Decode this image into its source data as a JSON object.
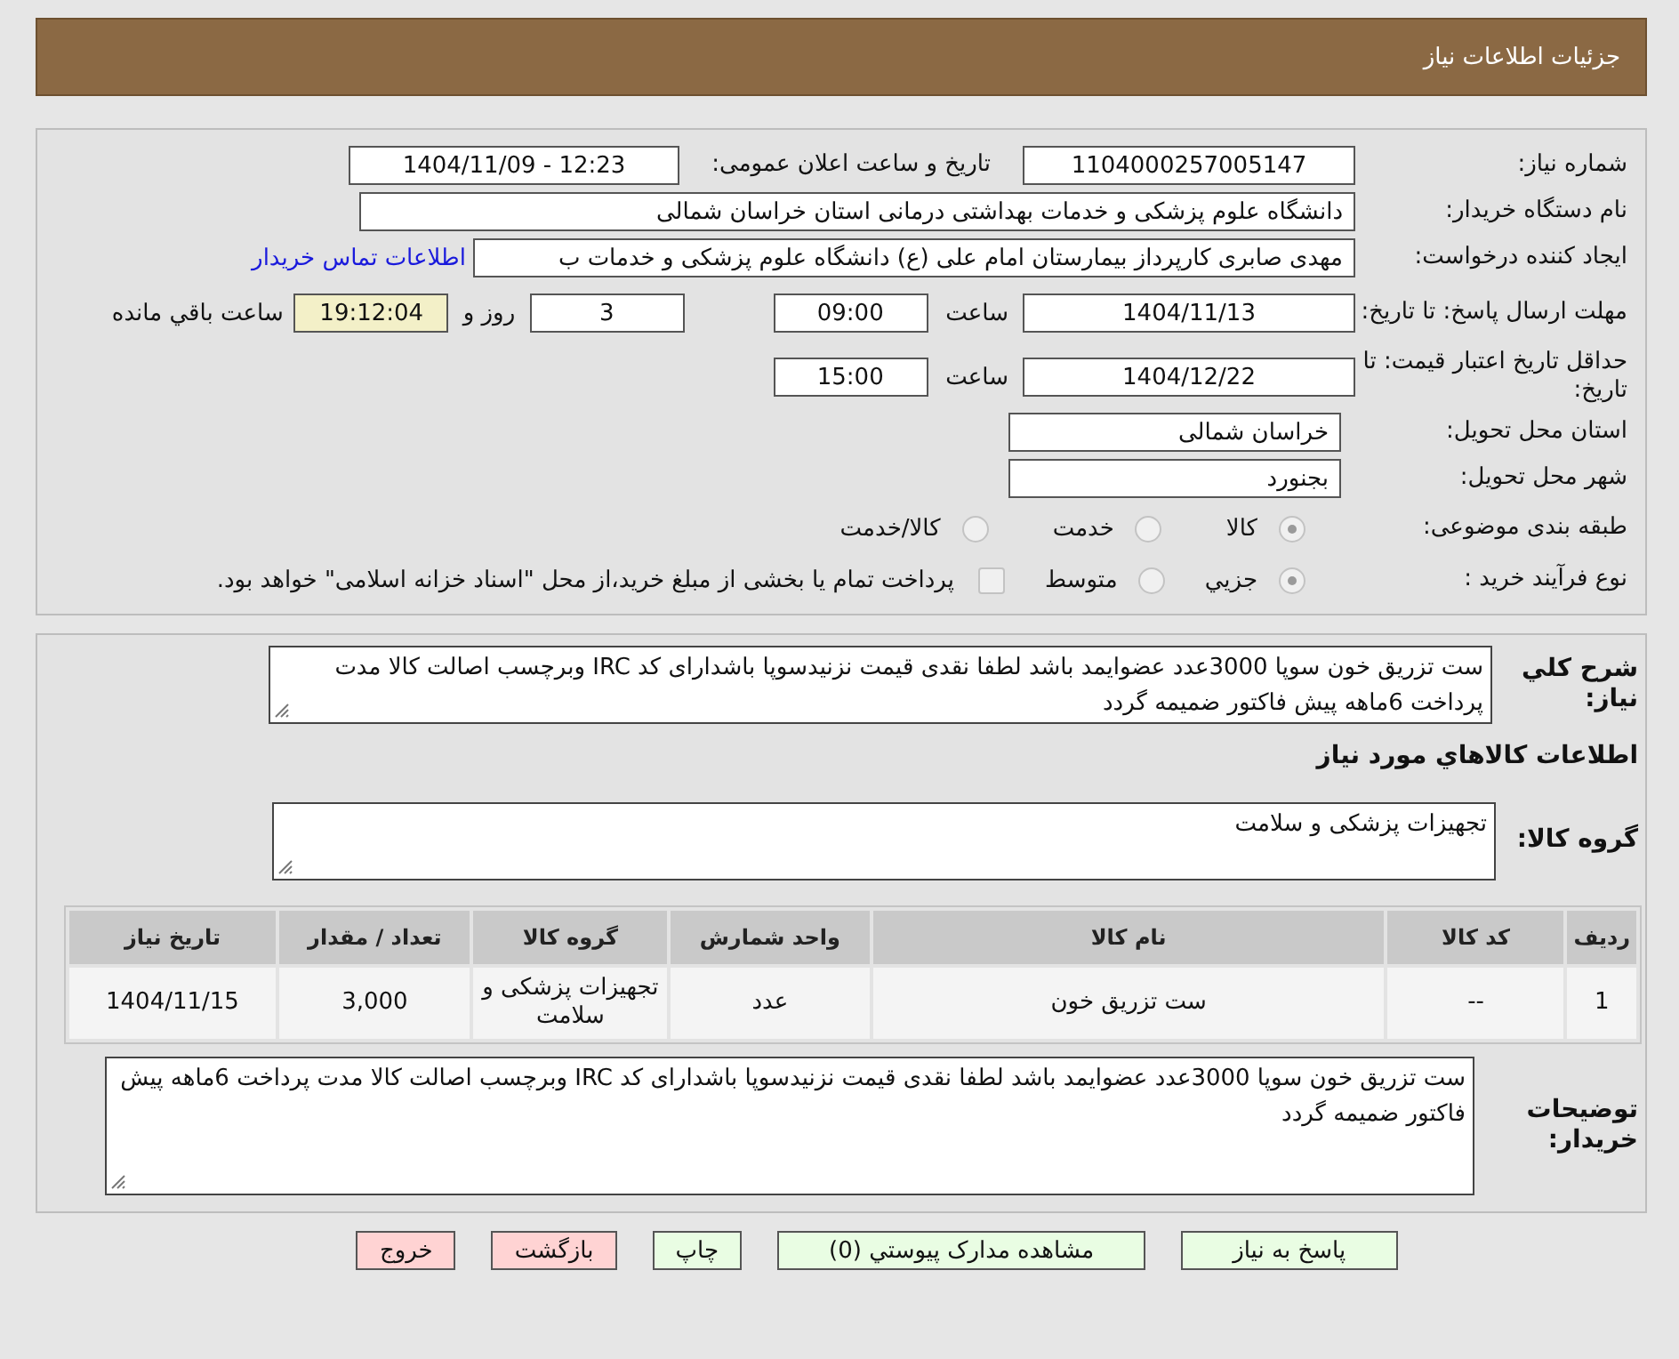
{
  "page_title": "جزئیات اطلاعات نیاز",
  "need_number": {
    "label": "شماره نیاز:",
    "value": "1104000257005147"
  },
  "announce": {
    "label": "تاریخ و ساعت اعلان عمومی:",
    "value": "1404/11/09 - 12:23"
  },
  "buyer_org": {
    "label": "نام دستگاه خریدار:",
    "value": "دانشگاه علوم پزشکی و خدمات بهداشتی درمانی استان خراسان شمالی"
  },
  "requester": {
    "label": "ایجاد کننده درخواست:",
    "value": "مهدی صابری کارپرداز بیمارستان امام علی (ع) دانشگاه علوم پزشکی و خدمات ب",
    "link": "اطلاعات تماس خریدار"
  },
  "deadline": {
    "label": "مهلت ارسال پاسخ: تا تاریخ:",
    "date": "1404/11/13",
    "time_label": "ساعت",
    "time": "09:00",
    "days": "3",
    "days_label": "روز و",
    "remaining": "19:12:04",
    "remaining_label": "ساعت باقي مانده"
  },
  "validity": {
    "label": "حداقل تاریخ اعتبار قیمت: تا تاریخ:",
    "date": "1404/12/22",
    "time_label": "ساعت",
    "time": "15:00"
  },
  "province": {
    "label": "استان محل تحویل:",
    "value": "خراسان شمالی"
  },
  "city": {
    "label": "شهر محل تحویل:",
    "value": "بجنورد"
  },
  "category": {
    "label": "طبقه بندی موضوعی:",
    "options": [
      {
        "label": "کالا",
        "selected": true
      },
      {
        "label": "خدمت",
        "selected": false
      },
      {
        "label": "کالا/خدمت",
        "selected": false
      }
    ]
  },
  "process": {
    "label": "نوع فرآیند خرید :",
    "options": [
      {
        "label": "جزيي",
        "selected": true
      },
      {
        "label": "متوسط",
        "selected": false
      }
    ],
    "treasury": {
      "checked": false,
      "label": "پرداخت تمام یا بخشی از مبلغ خرید،از محل \"اسناد خزانه اسلامی\" خواهد بود."
    }
  },
  "summary": {
    "label": "شرح کلي نياز:",
    "value": "ست تزریق خون سوپا 3000عدد عضوایمد باشد لطفا نقدی قیمت نزنیدسوپا باشدارای کد IRC وبرچسب اصالت کالا مدت پرداخت 6ماهه پیش فاکتور ضمیمه گردد"
  },
  "goods_heading": "اطلاعات کالاهاي مورد نياز",
  "goods_group": {
    "label": "گروه کالا:",
    "value": "تجهیزات پزشکی و سلامت"
  },
  "table": {
    "columns": [
      "ردیف",
      "کد کالا",
      "نام کالا",
      "واحد شمارش",
      "گروه کالا",
      "تعداد / مقدار",
      "تاریخ نیاز"
    ],
    "rows": [
      [
        "1",
        "--",
        "ست تزریق خون",
        "عدد",
        "تجهیزات پزشکی و سلامت",
        "3,000",
        "1404/11/15"
      ]
    ]
  },
  "buyer_notes": {
    "label": "توضیحات خریدار:",
    "value": "ست تزریق خون سوپا 3000عدد عضوایمد باشد لطفا نقدی قیمت نزنیدسوپا باشدارای کد IRC وبرچسب اصالت کالا مدت پرداخت 6ماهه پیش فاکتور ضمیمه گردد"
  },
  "buttons": [
    {
      "label": "پاسخ به نياز",
      "kind": "green"
    },
    {
      "label": "مشاهده مدارک پيوستي (0)",
      "kind": "green"
    },
    {
      "label": "چاپ",
      "kind": "green"
    },
    {
      "label": "بازگشت",
      "kind": "red"
    },
    {
      "label": "خروج",
      "kind": "red"
    }
  ]
}
